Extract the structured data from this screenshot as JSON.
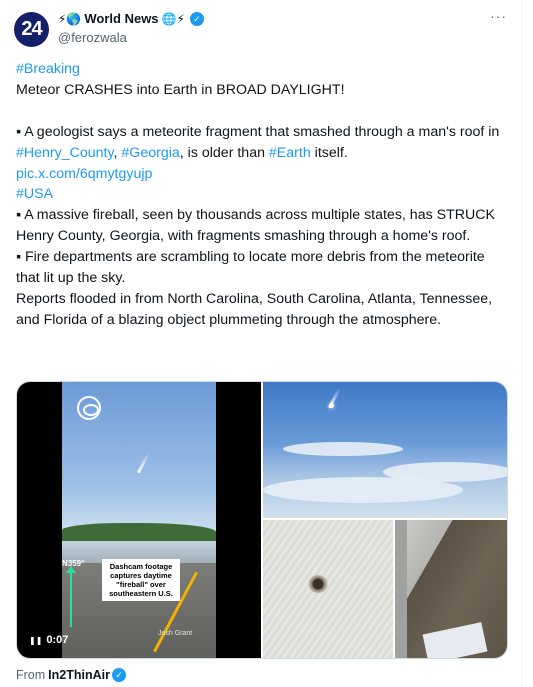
{
  "tweet": {
    "avatar_text": "24",
    "display_name": "World News",
    "name_emojis_left": "⚡🌎",
    "name_emojis_right": "🌐⚡",
    "handle": "@ferozwala",
    "more_label": "···",
    "verified_mark": "✓",
    "text": {
      "line1_hashtag": "#Breaking",
      "line2": "Meteor CRASHES into Earth in BROAD DAYLIGHT!",
      "para1_prefix": "▪ A geologist says a meteorite fragment that smashed through a man's roof in ",
      "para1_tag1": "#Henry_County",
      "para1_sep": ", ",
      "para1_tag2": "#Georgia",
      "para1_mid": ", is older than ",
      "para1_tag3": "#Earth",
      "para1_suffix": " itself.",
      "link": "pic.x.com/6qmytgyujp",
      "hashtag_usa": "#USA",
      "para2": "▪ A massive fireball, seen by thousands across multiple states, has STRUCK Henry County, Georgia, with fragments smashing through a home's roof.",
      "para3": "▪ Fire departments are scrambling to locate more debris from the meteorite that lit up the sky.",
      "para4": "Reports flooded in from North Carolina, South Carolina, Atlanta, Tennessee, and Florida of a blazing object plummeting through the atmosphere."
    },
    "media": {
      "video_heading": "N359°",
      "video_caption": "Dashcam footage captures daytime \"fireball\" over southeastern U.S.",
      "video_time": "0:07",
      "video_watermark": "Josh Grant",
      "video_play_icon": "❚❚"
    },
    "from_label": "From",
    "from_source": "In2ThinAir"
  },
  "colors": {
    "link": "#1d9bf0",
    "verified": "#1d9bf0",
    "avatar_bg": "#14216a",
    "muted": "#536471"
  }
}
